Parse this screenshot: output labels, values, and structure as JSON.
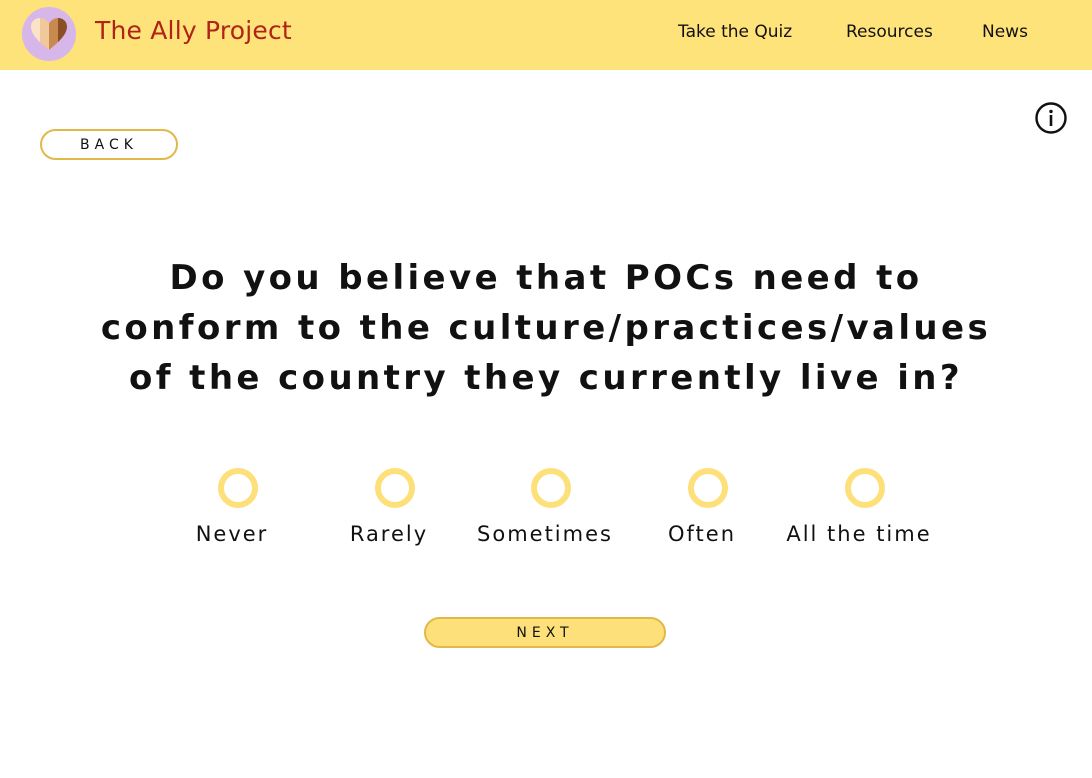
{
  "header": {
    "brand": "The Ally Project",
    "logo_icon": "heart-logo-icon",
    "nav": [
      {
        "label": "Take the Quiz"
      },
      {
        "label": "Resources"
      },
      {
        "label": "News"
      }
    ]
  },
  "info_icon": "info-icon",
  "back_label": "BACK",
  "question": {
    "line1": "Do you believe that POCs need to",
    "line2": "conform to the culture/practices/values",
    "line3": "of the country they currently live in?"
  },
  "options": [
    {
      "label": "Never",
      "selected": false
    },
    {
      "label": "Rarely",
      "selected": false
    },
    {
      "label": "Sometimes",
      "selected": false
    },
    {
      "label": "Often",
      "selected": false
    },
    {
      "label": "All the time",
      "selected": false
    }
  ],
  "next_label": "NEXT",
  "colors": {
    "header_bg": "#fee27a",
    "brand_text": "#b02418",
    "accent": "#fde07a",
    "button_border": "#e2b84a",
    "logo_circle": "#d7b6ea"
  }
}
